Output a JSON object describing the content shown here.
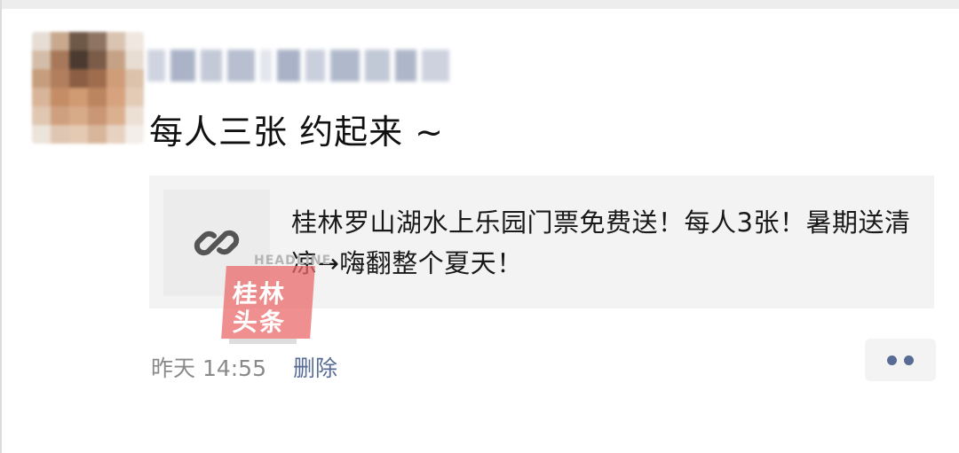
{
  "post": {
    "text": "每人三张 约起来 ~"
  },
  "link_card": {
    "icon": "link-icon",
    "title": "桂林罗山湖水上乐园门票免费送！每人3张！暑期送清凉→嗨翻整个夏天！"
  },
  "watermark": {
    "top_text": "HEADLINE",
    "line1": "桂林",
    "line2": "头条"
  },
  "footer": {
    "timestamp": "昨天 14:55",
    "delete_label": "删除",
    "more_icon": "more-dots-icon"
  },
  "colors": {
    "link_blue": "#576b95",
    "card_bg": "#f3f3f3",
    "watermark_red": "#e96a6a"
  }
}
